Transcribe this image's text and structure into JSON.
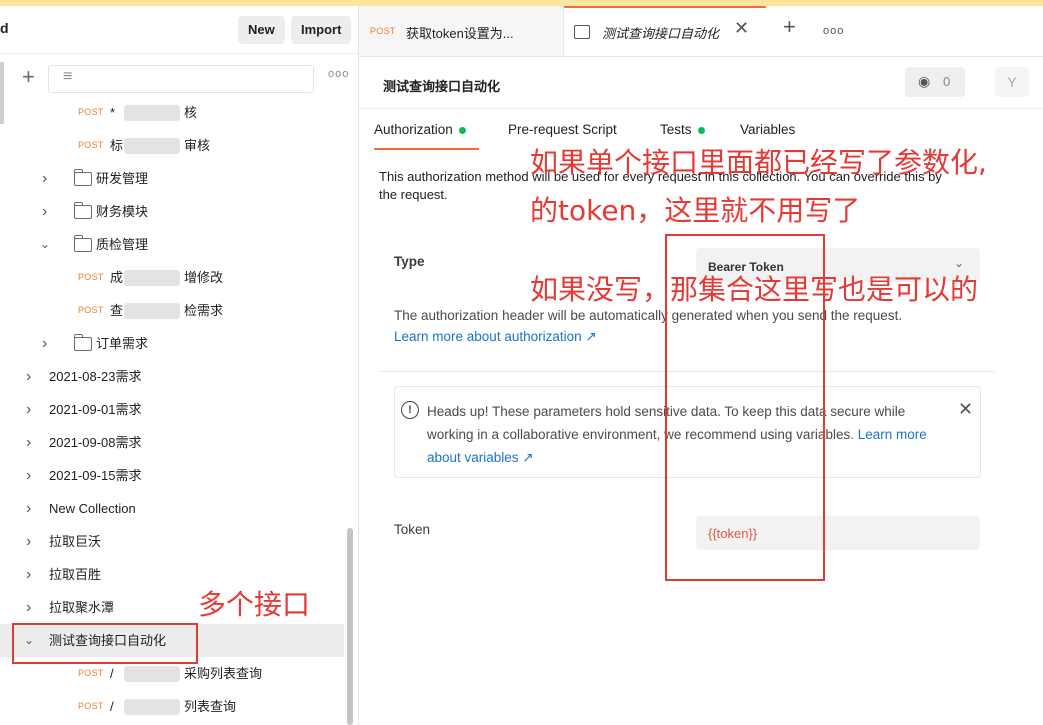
{
  "sidebar": {
    "ws_letter": "d",
    "new_label": "New",
    "import_label": "Import",
    "tree": [
      {
        "kind": "request",
        "method": "POST",
        "label_a": "*",
        "label_b": "核"
      },
      {
        "kind": "request",
        "method": "POST",
        "label_a": "标",
        "label_b": "审核"
      },
      {
        "kind": "folder",
        "label": "研发管理",
        "expanded": false
      },
      {
        "kind": "folder",
        "label": "财务模块",
        "expanded": false
      },
      {
        "kind": "folder",
        "label": "质检管理",
        "expanded": true
      },
      {
        "kind": "request",
        "method": "POST",
        "label_a": "成",
        "label_b": "增修改"
      },
      {
        "kind": "request",
        "method": "POST",
        "label_a": "查",
        "label_b": "检需求"
      },
      {
        "kind": "folder",
        "label": "订单需求",
        "expanded": false
      },
      {
        "kind": "collection",
        "label": "2021-08-23需求"
      },
      {
        "kind": "collection",
        "label": "2021-09-01需求"
      },
      {
        "kind": "collection",
        "label": "2021-09-08需求"
      },
      {
        "kind": "collection",
        "label": "2021-09-15需求"
      },
      {
        "kind": "collection",
        "label": "New Collection"
      },
      {
        "kind": "collection",
        "label": "拉取巨沃"
      },
      {
        "kind": "collection",
        "label": "拉取百胜"
      },
      {
        "kind": "collection",
        "label": "拉取聚水潭"
      },
      {
        "kind": "collection",
        "label": "测试查询接口自动化",
        "selected": true
      },
      {
        "kind": "request",
        "method": "POST",
        "label_a": "/",
        "label_b": "采购列表查询"
      },
      {
        "kind": "request",
        "method": "POST",
        "label_a": "/",
        "label_b": "列表查询"
      }
    ]
  },
  "tabs": {
    "tab1_method": "POST",
    "tab1_title": "获取token设置为...",
    "tab2_title": "测试查询接口自动化"
  },
  "collection": {
    "title": "测试查询接口自动化",
    "watch_count": "0"
  },
  "subtabs": {
    "authorization": "Authorization",
    "prerequest": "Pre-request Script",
    "tests": "Tests",
    "variables": "Variables",
    "status_color": "#0cbb52"
  },
  "auth": {
    "description_line1": "This authorization method will be used for every request in this collection. You can override this by",
    "description_line2": "the request.",
    "type_label": "Type",
    "type_value": "Bearer Token",
    "help_text": "The authorization header will be automatically generated when you send the request.",
    "learn_link": "Learn more about authorization ↗",
    "headsup_text": "Heads up! These parameters hold sensitive data. To keep this data secure while working in a collaborative environment, we recommend using variables.",
    "headsup_link": "Learn more about variables ↗",
    "token_label": "Token",
    "token_value": "{{token}}"
  },
  "annotations": {
    "line1": "如果单个接口里面都已经写了参数化,",
    "line2": "的token，这里就不用写了",
    "line3": "如果没写，那集合这里写也是可以的",
    "sidebar_note": "多个接口",
    "color": "#e53935"
  }
}
